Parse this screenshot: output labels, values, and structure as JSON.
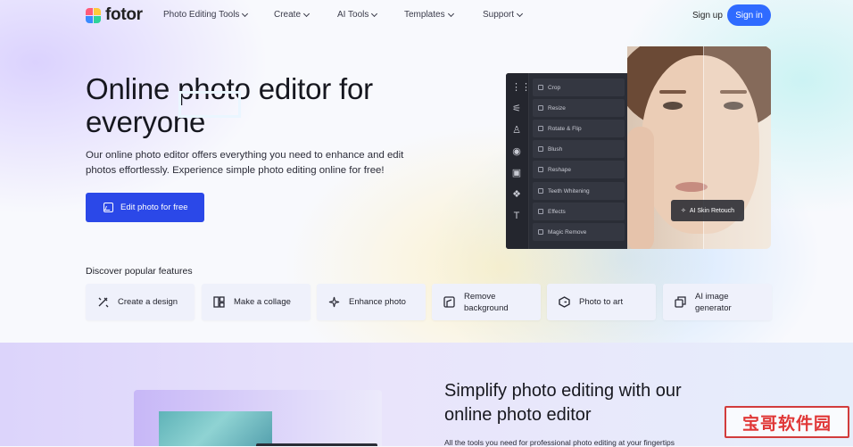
{
  "header": {
    "logo_text": "fotor",
    "nav": [
      {
        "label": "Photo Editing Tools"
      },
      {
        "label": "Create"
      },
      {
        "label": "AI Tools"
      },
      {
        "label": "Templates"
      },
      {
        "label": "Support"
      }
    ],
    "signup_label": "Sign up",
    "signin_label": "Sign in"
  },
  "hero": {
    "title": "Online photo editor for everyone",
    "subtitle": "Our online photo editor offers everything you need to enhance and edit photos effortlessly. Experience simple photo editing online for free!",
    "cta_label": "Edit photo for free"
  },
  "editor": {
    "tools": [
      "Crop",
      "Resize",
      "Rotate & Flip",
      "Blush",
      "Reshape",
      "Teeth Whitening",
      "Effects",
      "Magic Remove"
    ],
    "badge_label": "AI Skin Retouch"
  },
  "features": {
    "heading": "Discover popular features",
    "items": [
      {
        "label": "Create a design",
        "icon": "magic-wand-icon"
      },
      {
        "label": "Make a collage",
        "icon": "collage-icon"
      },
      {
        "label": "Enhance photo",
        "icon": "sparkle-icon"
      },
      {
        "label": "Remove background",
        "icon": "cutout-icon"
      },
      {
        "label": "Photo to art",
        "icon": "art-icon"
      },
      {
        "label": "AI image generator",
        "icon": "image-generator-icon"
      }
    ]
  },
  "section2": {
    "title": "Simplify photo editing with our online photo editor",
    "text": "All the tools you need for professional photo editing at your fingertips"
  },
  "watermark": {
    "text": "宝哥软件园"
  },
  "colors": {
    "primary": "#2b48e8",
    "signin": "#2f6bff",
    "editor_bg": "#2a2d36"
  }
}
